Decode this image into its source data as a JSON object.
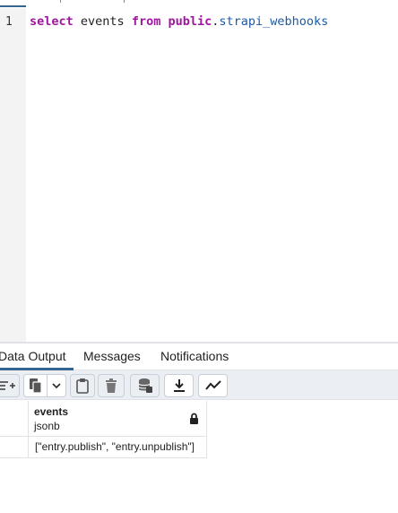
{
  "editor": {
    "line_number": "1",
    "query": {
      "kw_select": "select",
      "column": " events ",
      "kw_from": "from",
      "space": " ",
      "schema": "public",
      "dot": ".",
      "table": "strapi_webhooks"
    }
  },
  "result_tabs": {
    "data_output": "Data Output",
    "messages": "Messages",
    "notifications": "Notifications",
    "active": "Data Output"
  },
  "toolbar": {
    "icons": [
      "add-row-icon",
      "copy-icon",
      "chevron-down-icon",
      "paste-icon",
      "delete-icon",
      "save-data-icon",
      "download-icon",
      "graph-visualiser-icon"
    ]
  },
  "grid": {
    "columns": [
      {
        "name": "events",
        "type": "jsonb",
        "locked": true
      }
    ],
    "rows": [
      [
        "[\"entry.publish\", \"entry.unpublish\"]"
      ]
    ]
  },
  "colors": {
    "keyword": "#a0159e",
    "identifier": "#1c5aa8",
    "accent": "#326690",
    "toolbar_bg": "#ebeef3"
  }
}
